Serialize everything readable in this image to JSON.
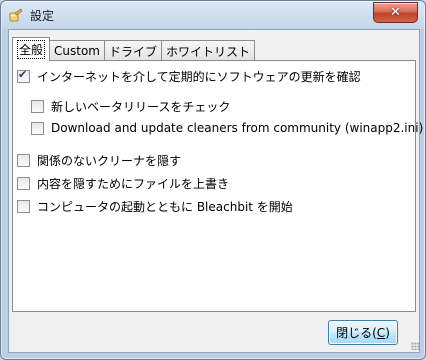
{
  "window": {
    "title": "設定",
    "close_glyph": "✕"
  },
  "tabs": [
    {
      "label": "全般",
      "active": true
    },
    {
      "label": "Custom",
      "active": false
    },
    {
      "label": "ドライブ",
      "active": false
    },
    {
      "label": "ホワイトリスト",
      "active": false
    }
  ],
  "options": {
    "check_update": {
      "label": "インターネットを介して定期的にソフトウェアの更新を確認",
      "checked": true
    },
    "check_beta": {
      "label": "新しいベータリリースをチェック",
      "checked": false
    },
    "download_cleaners": {
      "label": "Download and update cleaners from community (winapp2.ini)",
      "checked": false
    },
    "hide_irrelevant": {
      "label": "関係のないクリーナを隠す",
      "checked": false
    },
    "overwrite": {
      "label": "内容を隠すためにファイルを上書き",
      "checked": false
    },
    "autostart": {
      "label": "コンピュータの起動とともに Bleachbit を開始",
      "checked": false
    }
  },
  "close_button": {
    "label_prefix": "閉じる(",
    "mnemonic": "C",
    "label_suffix": ")"
  },
  "icons": {
    "app": "bleachbit-app-icon",
    "window_close": "close-icon"
  }
}
